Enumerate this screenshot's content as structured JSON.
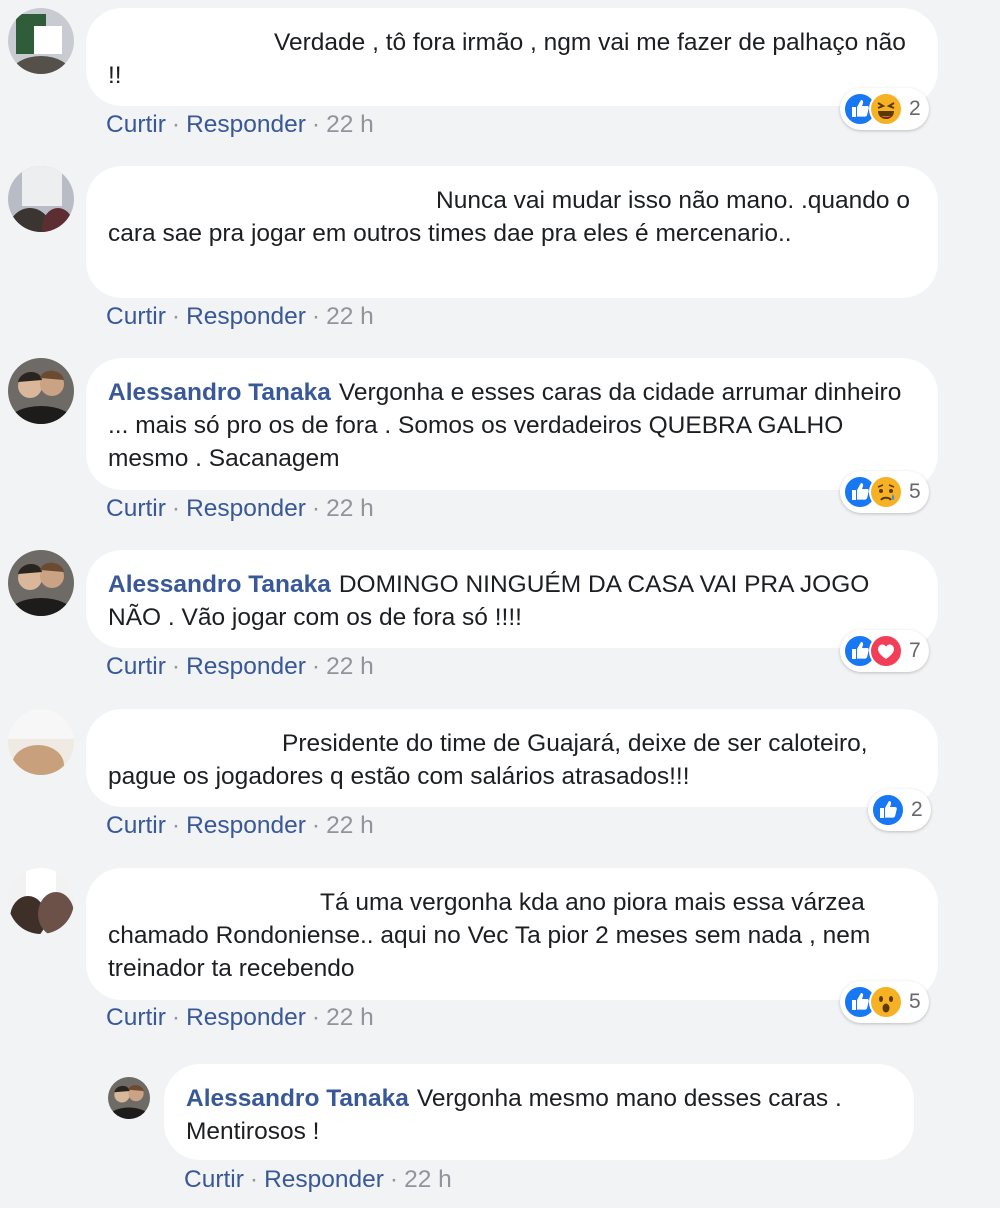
{
  "comments": [
    {
      "author": "",
      "text": "Verdade , tô fora irmão , ngm vai me fazer de palhaço não !!",
      "actions": {
        "like": "Curtir",
        "reply": "Responder",
        "time": "22 h"
      },
      "reactions": {
        "icons": [
          "like-icon",
          "haha-icon"
        ],
        "count": "2"
      }
    },
    {
      "author": "",
      "text": "Nunca vai mudar isso não mano. .quando o cara sae pra jogar em outros times dae pra eles é mercenario..",
      "actions": {
        "like": "Curtir",
        "reply": "Responder",
        "time": "22 h"
      },
      "reactions": null
    },
    {
      "author": "Alessandro Tanaka",
      "text": "Vergonha e esses caras da cidade arrumar dinheiro ... mais só pro os de fora . Somos os verdadeiros QUEBRA GALHO mesmo . Sacanagem",
      "actions": {
        "like": "Curtir",
        "reply": "Responder",
        "time": "22 h"
      },
      "reactions": {
        "icons": [
          "like-icon",
          "sad-icon"
        ],
        "count": "5"
      }
    },
    {
      "author": "Alessandro Tanaka",
      "text": "DOMINGO NINGUÉM DA CASA VAI PRA JOGO NÃO . Vão jogar com os de fora só !!!!",
      "actions": {
        "like": "Curtir",
        "reply": "Responder",
        "time": "22 h"
      },
      "reactions": {
        "icons": [
          "like-icon",
          "love-icon"
        ],
        "count": "7"
      }
    },
    {
      "author": "",
      "text": "Presidente do time de Guajará, deixe de ser caloteiro, pague os jogadores q estão com salários atrasados!!!",
      "actions": {
        "like": "Curtir",
        "reply": "Responder",
        "time": "22 h"
      },
      "reactions": {
        "icons": [
          "like-icon"
        ],
        "count": "2"
      }
    },
    {
      "author": "",
      "text": "Tá uma vergonha kda ano piora mais essa várzea chamado Rondoniense.. aqui no Vec Ta pior 2 meses sem nada , nem treinador ta recebendo",
      "actions": {
        "like": "Curtir",
        "reply": "Responder",
        "time": "22 h"
      },
      "reactions": {
        "icons": [
          "like-icon",
          "wow-icon"
        ],
        "count": "5"
      }
    },
    {
      "author": "Alessandro Tanaka",
      "text": "Vergonha mesmo mano desses caras . Mentirosos !",
      "actions": {
        "like": "Curtir",
        "reply": "Responder",
        "time": "22 h"
      },
      "reactions": null
    }
  ],
  "colors": {
    "background": "#f2f3f5",
    "bubble": "#ffffff",
    "author": "#385898",
    "link": "#385898",
    "meta": "#90949c",
    "like_blue": "#1877f2",
    "love_red": "#f33e58",
    "emoji_yellow": "#f7b125"
  }
}
